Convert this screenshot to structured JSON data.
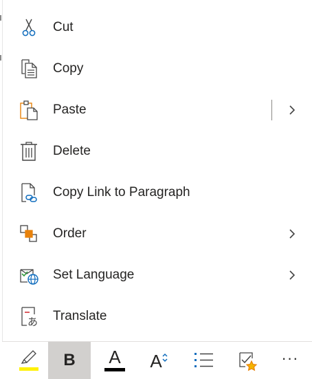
{
  "menu": {
    "items": [
      {
        "label": "Cut",
        "icon": "scissors-icon",
        "has_submenu": false
      },
      {
        "label": "Copy",
        "icon": "copy-icon",
        "has_submenu": false
      },
      {
        "label": "Paste",
        "icon": "paste-icon",
        "has_submenu": true,
        "split": true
      },
      {
        "label": "Delete",
        "icon": "trash-icon",
        "has_submenu": false
      },
      {
        "label": "Copy Link to Paragraph",
        "icon": "link-document-icon",
        "has_submenu": false
      },
      {
        "label": "Order",
        "icon": "order-icon",
        "has_submenu": true
      },
      {
        "label": "Set Language",
        "icon": "language-globe-icon",
        "has_submenu": true
      },
      {
        "label": "Translate",
        "icon": "translate-icon",
        "has_submenu": false
      }
    ]
  },
  "toolbar": {
    "bold_label": "B",
    "font_color_letter": "A",
    "font_size_letter": "A",
    "more_label": "···",
    "buttons": [
      {
        "icon": "highlighter-icon",
        "color": "#fff100"
      },
      {
        "icon": "bold-icon",
        "active": true
      },
      {
        "icon": "font-color-icon",
        "color": "#000000"
      },
      {
        "icon": "font-size-icon"
      },
      {
        "icon": "bullets-icon"
      },
      {
        "icon": "checklist-star-icon"
      },
      {
        "icon": "more-icon"
      }
    ]
  },
  "colors": {
    "text": "#252423",
    "accent_blue": "#0f6cbd",
    "accent_orange": "#e8820c",
    "highlight_yellow": "#fff100",
    "active_bg": "#d2d0ce"
  }
}
